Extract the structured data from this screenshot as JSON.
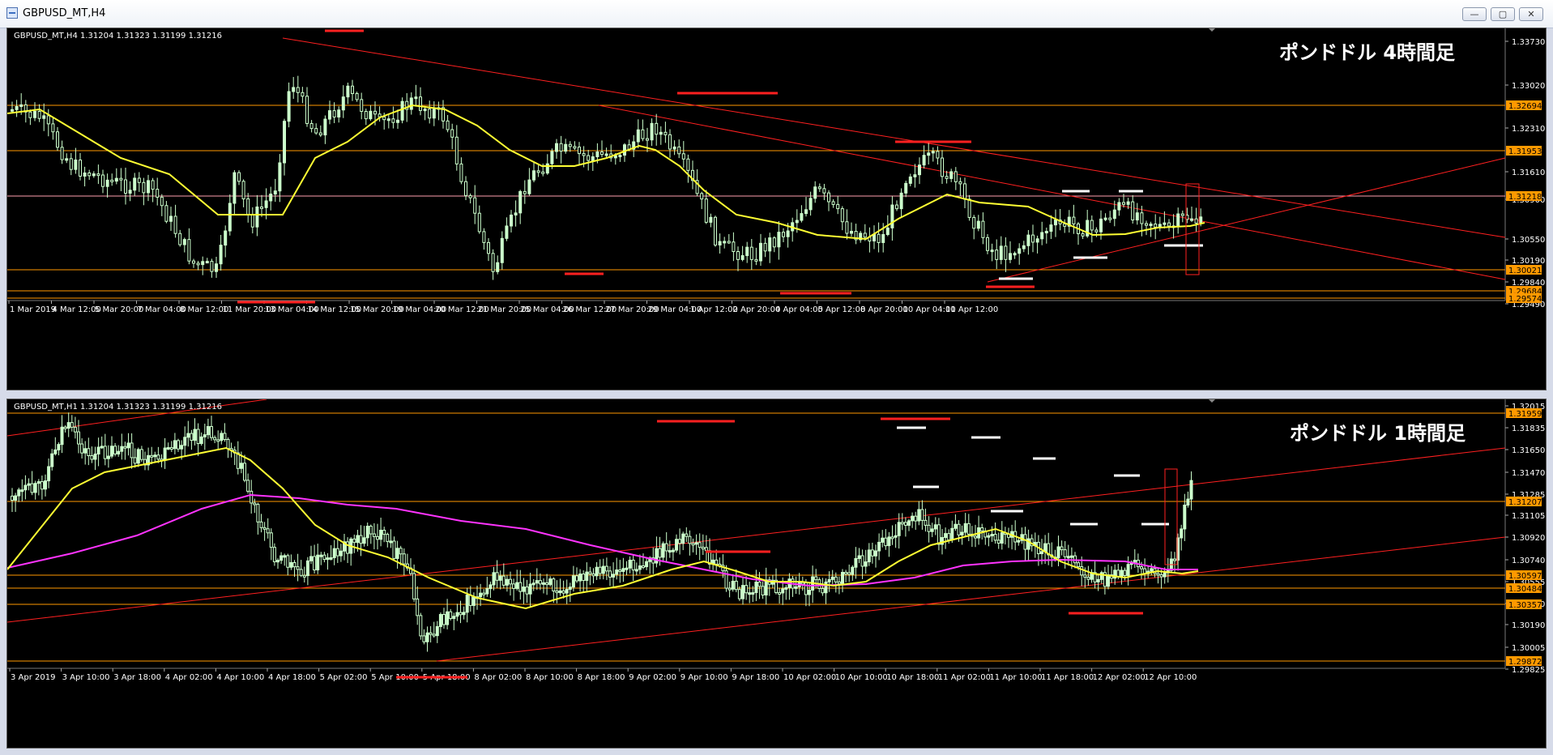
{
  "window": {
    "title": "GBPUSD_MT,H4",
    "buttons": {
      "minimize": "—",
      "restore": "▢",
      "close": "✕"
    }
  },
  "colors": {
    "background": "#000000",
    "bull_candle": "#ccffcc",
    "bear_candle": "#000000",
    "candle_outline": "#ccffcc",
    "level_line": "#ff9900",
    "trend_line": "#ff2020",
    "ma_fast": "#ffff33",
    "ma_slow": "#ff33ff",
    "marker_red": "#ff2020",
    "marker_white": "#ffffff"
  },
  "charts": {
    "h4": {
      "info": "GBPUSD_MT,H4  1.31204 1.31323 1.31199 1.31216",
      "name": "ポンドドル 4時間足",
      "y_ticks": [
        "1.33730",
        "1.33020",
        "1.32310",
        "1.31610",
        "1.30900",
        "1.30550",
        "1.30190",
        "1.29840",
        "1.29490"
      ],
      "level_tags": [
        "1.32694",
        "1.31953",
        "1.31218",
        "1.30021",
        "1.29684",
        "1.29574"
      ],
      "x_labels": [
        "1 Mar 2019",
        "4 Mar 12:00",
        "5 Mar 20:00",
        "7 Mar 04:00",
        "8 Mar 12:00",
        "11 Mar 20:00",
        "13 Mar 04:00",
        "14 Mar 12:00",
        "15 Mar 20:00",
        "19 Mar 04:00",
        "20 Mar 12:00",
        "21 Mar 20:00",
        "25 Mar 04:00",
        "26 Mar 12:00",
        "27 Mar 20:00",
        "29 Mar 04:00",
        "1 Apr 12:00",
        "2 Apr 20:00",
        "4 Apr 04:00",
        "5 Apr 12:00",
        "8 Apr 20:00",
        "10 Apr 04:00",
        "11 Apr 12:00"
      ]
    },
    "h1": {
      "info": "GBPUSD_MT,H1  1.31204 1.31323 1.31199 1.31216",
      "name": "ポンドドル 1時間足",
      "y_ticks": [
        "1.32015",
        "1.31835",
        "1.31650",
        "1.31470",
        "1.31285",
        "1.31105",
        "1.30920",
        "1.30740",
        "1.30555",
        "1.30370",
        "1.30190",
        "1.30005",
        "1.29825"
      ],
      "level_tags": [
        "1.31959",
        "1.31207",
        "1.30597",
        "1.30484",
        "1.30357",
        "1.29872"
      ],
      "x_labels": [
        "3 Apr 2019",
        "3 Apr 10:00",
        "3 Apr 18:00",
        "4 Apr 02:00",
        "4 Apr 10:00",
        "4 Apr 18:00",
        "5 Apr 02:00",
        "5 Apr 10:00",
        "5 Apr 18:00",
        "8 Apr 02:00",
        "8 Apr 10:00",
        "8 Apr 18:00",
        "9 Apr 02:00",
        "9 Apr 10:00",
        "9 Apr 18:00",
        "10 Apr 02:00",
        "10 Apr 10:00",
        "10 Apr 18:00",
        "11 Apr 02:00",
        "11 Apr 10:00",
        "11 Apr 18:00",
        "12 Apr 02:00",
        "12 Apr 10:00"
      ]
    }
  }
}
